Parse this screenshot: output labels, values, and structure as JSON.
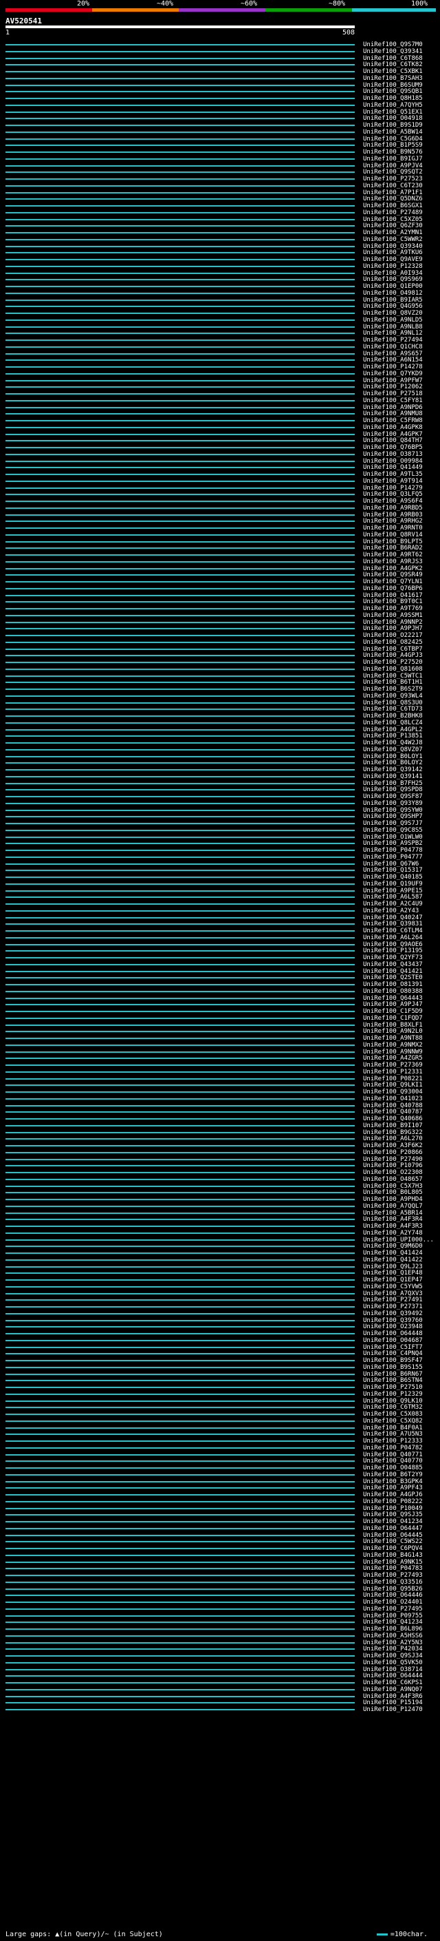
{
  "legend": {
    "labels": [
      "20%",
      "~40%",
      "~60%",
      "~80%",
      "100%"
    ],
    "colors": [
      "#e0001a",
      "#ee7a00",
      "#9a34c9",
      "#0aa00a",
      "#26c6d0"
    ]
  },
  "query": {
    "title": "AV520541",
    "start": "1",
    "end": "508"
  },
  "hits": [
    "UniRef100_Q9S7M0",
    "UniRef100_Q39341",
    "UniRef100_C6T868",
    "UniRef100_C6TK82",
    "UniRef100_C5XBK1",
    "UniRef100_B7SAH3",
    "UniRef100_B6SUM9",
    "UniRef100_Q9SQB1",
    "UniRef100_Q8H185",
    "UniRef100_A7QYH5",
    "UniRef100_Q51EX1",
    "UniRef100_O04918",
    "UniRef100_B9S1D9",
    "UniRef100_A5BW14",
    "UniRef100_C5G6D4",
    "UniRef100_B1P5S9",
    "UniRef100_B9N576",
    "UniRef100_B9IGJ7",
    "UniRef100_A9PJV4",
    "UniRef100_Q9SQT2",
    "UniRef100_P27523",
    "UniRef100_C6T230",
    "UniRef100_A7P1F1",
    "UniRef100_Q5DNZ6",
    "UniRef100_B6SGX1",
    "UniRef100_P27489",
    "UniRef100_C5XZ05",
    "UniRef100_Q6ZF30",
    "UniRef100_A2YMN1",
    "UniRef100_C5WWR2",
    "UniRef100_Q39340",
    "UniRef100_A9TKU6",
    "UniRef100_Q9AVE9",
    "UniRef100_P12328",
    "UniRef100_A0I934",
    "UniRef100_Q9S969",
    "UniRef100_Q1EP00",
    "UniRef100_O49812",
    "UniRef100_B9IAR5",
    "UniRef100_Q4G956",
    "UniRef100_Q8VZ20",
    "UniRef100_A9NLD5",
    "UniRef100_A9NLB8",
    "UniRef100_A9NL12",
    "UniRef100_P27494",
    "UniRef100_Q1CHC8",
    "UniRef100_A9S657",
    "UniRef100_A6N154",
    "UniRef100_P14278",
    "UniRef100_Q7YKD9",
    "UniRef100_A9PFW7",
    "UniRef100_P12062",
    "UniRef100_P27518",
    "UniRef100_C5FY81",
    "UniRef100_A9NPD6",
    "UniRef100_A9NMU8",
    "UniRef100_C5FRW8",
    "UniRef100_A4GPK8",
    "UniRef100_A4GPK7",
    "UniRef100_Q84TH7",
    "UniRef100_Q76BP5",
    "UniRef100_O38713",
    "UniRef100_O09984",
    "UniRef100_Q41449",
    "UniRef100_A9TL35",
    "UniRef100_A9T914",
    "UniRef100_P14279",
    "UniRef100_Q3LFQ5",
    "UniRef100_A9S6F4",
    "UniRef100_A9RBD5",
    "UniRef100_A9RB03",
    "UniRef100_A9RHG2",
    "UniRef100_A9RNT0",
    "UniRef100_Q8RV14",
    "UniRef100_B9LPT5",
    "UniRef100_B6RAD2",
    "UniRef100_A9RT62",
    "UniRef100_A9RJS3",
    "UniRef100_A4GPK2",
    "UniRef100_Q9SR49",
    "UniRef100_Q7YLN1",
    "UniRef100_Q76BP6",
    "UniRef100_O41617",
    "UniRef100_B9T0C1",
    "UniRef100_A9T769",
    "UniRef100_A9SSM1",
    "UniRef100_A9NNP2",
    "UniRef100_A9PJH7",
    "UniRef100_O22217",
    "UniRef100_O82425",
    "UniRef100_C6TBP7",
    "UniRef100_A4GPJ3",
    "UniRef100_P27520",
    "UniRef100_Q81608",
    "UniRef100_C5WTC1",
    "UniRef100_B6T1H1",
    "UniRef100_B6S2T9",
    "UniRef100_Q93WL4",
    "UniRef100_Q8S3U0",
    "UniRef100_C6TD73",
    "UniRef100_B2BHK8",
    "UniRef100_Q8LCZ4",
    "UniRef100_A4GPL2",
    "UniRef100_P13851",
    "UniRef100_Q4W2J8",
    "UniRef100_Q8VZ07",
    "UniRef100_B0LOY1",
    "UniRef100_B0LOY2",
    "UniRef100_Q39142",
    "UniRef100_Q39141",
    "UniRef100_B7FH25",
    "UniRef100_Q9SPD8",
    "UniRef100_Q9SF87",
    "UniRef100_Q93Y89",
    "UniRef100_Q9SYW0",
    "UniRef100_Q9SHP7",
    "UniRef100_Q9S7J7",
    "UniRef100_Q9C8S5",
    "UniRef100_O1WLW0",
    "UniRef100_A9SPB2",
    "UniRef100_P04778",
    "UniRef100_P04777",
    "UniRef100_Q67W6",
    "UniRef100_Q15317",
    "UniRef100_Q40185",
    "UniRef100_Q19UF9",
    "UniRef100_A9PE15",
    "UniRef100_A6L587",
    "UniRef100_A2C4U9",
    "UniRef100_A2Y43",
    "UniRef100_Q40247",
    "UniRef100_Q39831",
    "UniRef100_C6TLM4",
    "UniRef100_A6L264",
    "UniRef100_Q9AOE6",
    "UniRef100_P13195",
    "UniRef100_Q2YF73",
    "UniRef100_Q43437",
    "UniRef100_Q41421",
    "UniRef100_Q2STE0",
    "UniRef100_O81391",
    "UniRef100_O80388",
    "UniRef100_Q64443",
    "UniRef100_A9PJ47",
    "UniRef100_C1F5D9",
    "UniRef100_C1FQD7",
    "UniRef100_B8XLF1",
    "UniRef100_A9N2L0",
    "UniRef100_A9NT88",
    "UniRef100_A9NMX2",
    "UniRef100_A9NNW9",
    "UniRef100_A4ZGR5",
    "UniRef100_P27369",
    "UniRef100_P12331",
    "UniRef100_P08221",
    "UniRef100_Q9LKI1",
    "UniRef100_Q93004",
    "UniRef100_O41023",
    "UniRef100_Q40788",
    "UniRef100_Q40787",
    "UniRef100_Q40686",
    "UniRef100_B9I107",
    "UniRef100_B9G322",
    "UniRef100_A6L270",
    "UniRef100_A3F6K2",
    "UniRef100_P20866",
    "UniRef100_P27490",
    "UniRef100_P10796",
    "UniRef100_O22308",
    "UniRef100_O48657",
    "UniRef100_C5X7H3",
    "UniRef100_B0L805",
    "UniRef100_A9PHD4",
    "UniRef100_A7QQL7",
    "UniRef100_A5BR14",
    "UniRef100_A4F3R4",
    "UniRef100_A4F3R3",
    "UniRef100_A2Y748",
    "UniRef100_UPI000...",
    "UniRef100_Q9M6D0",
    "UniRef100_Q41424",
    "UniRef100_Q41422",
    "UniRef100_Q9LJ23",
    "UniRef100_Q1EP48",
    "UniRef100_Q1EP47",
    "UniRef100_C5YVW5",
    "UniRef100_A7QXV3",
    "UniRef100_P27491",
    "UniRef100_P27371",
    "UniRef100_Q39492",
    "UniRef100_Q39760",
    "UniRef100_O23948",
    "UniRef100_O64448",
    "UniRef100_O04687",
    "UniRef100_C5IFT7",
    "UniRef100_C4PNQ4",
    "UniRef100_B9SF47",
    "UniRef100_B9S155",
    "UniRef100_B6RN67",
    "UniRef100_B6STN4",
    "UniRef100_P27510",
    "UniRef100_P12329",
    "UniRef100_Q9LK10",
    "UniRef100_C6TM32",
    "UniRef100_C5X083",
    "UniRef100_C5XQ82",
    "UniRef100_B4F0A1",
    "UniRef100_A7U5N3",
    "UniRef100_P12333",
    "UniRef100_P04782",
    "UniRef100_Q40771",
    "UniRef100_Q40770",
    "UniRef100_O04885",
    "UniRef100_B6T2Y9",
    "UniRef100_B3GPK4",
    "UniRef100_A9PF43",
    "UniRef100_A4GPJ6",
    "UniRef100_P08222",
    "UniRef100_P10049",
    "UniRef100_Q9SJ35",
    "UniRef100_O41234",
    "UniRef100_O64447",
    "UniRef100_O64445",
    "UniRef100_C5WS22",
    "UniRef100_C6PQV4",
    "UniRef100_B4G143",
    "UniRef100_A9NK15",
    "UniRef100_P04783",
    "UniRef100_P27493",
    "UniRef100_Q33516",
    "UniRef100_Q95B26",
    "UniRef100_O64446",
    "UniRef100_O24401",
    "UniRef100_P27495",
    "UniRef100_P09755",
    "UniRef100_Q41234",
    "UniRef100_B6L896",
    "UniRef100_A5HSS6",
    "UniRef100_A2Y5N3",
    "UniRef100_P42034",
    "UniRef100_Q9SJ34",
    "UniRef100_Q5VK50",
    "UniRef100_O38714",
    "UniRef100_O64444",
    "UniRef100_C6KPS1",
    "UniRef100_A9NQ07",
    "UniRef100_A4F3R6",
    "UniRef100_P15194",
    "UniRef100_P12470"
  ],
  "footer": {
    "gaps_label": "Large gaps: ▲(in Query)/~ (in Subject)",
    "scale_label": "=100char."
  }
}
